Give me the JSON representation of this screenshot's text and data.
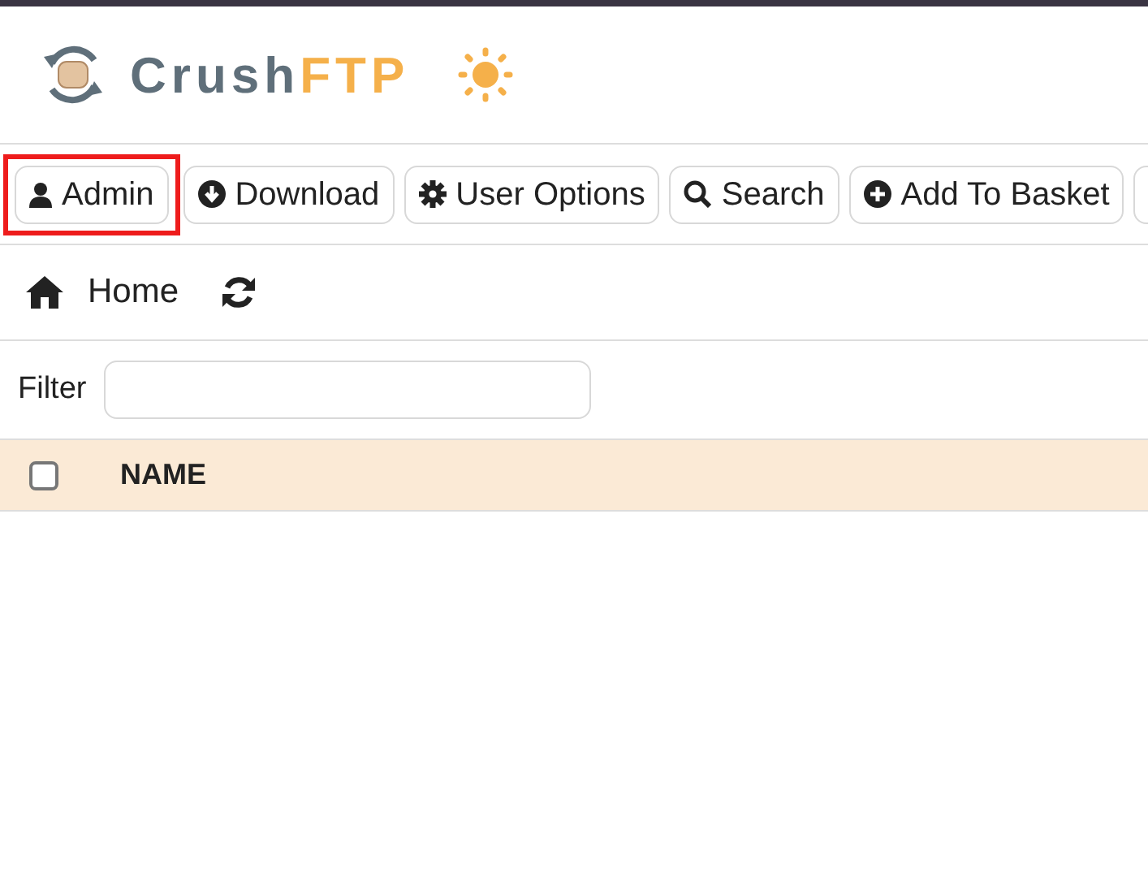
{
  "logo": {
    "name_part": "Crush",
    "accent_part": "FTP"
  },
  "toolbar": [
    {
      "label": "Admin",
      "highlighted": true
    },
    {
      "label": "Download",
      "highlighted": false
    },
    {
      "label": "User Options",
      "highlighted": false
    },
    {
      "label": "Search",
      "highlighted": false
    },
    {
      "label": "Add To Basket",
      "highlighted": false
    },
    {
      "highlighted": false
    }
  ],
  "breadcrumb": {
    "label": "Home"
  },
  "filter": {
    "label": "Filter"
  },
  "table": {
    "select_all_checked": false,
    "columns": [
      "NAME"
    ]
  }
}
